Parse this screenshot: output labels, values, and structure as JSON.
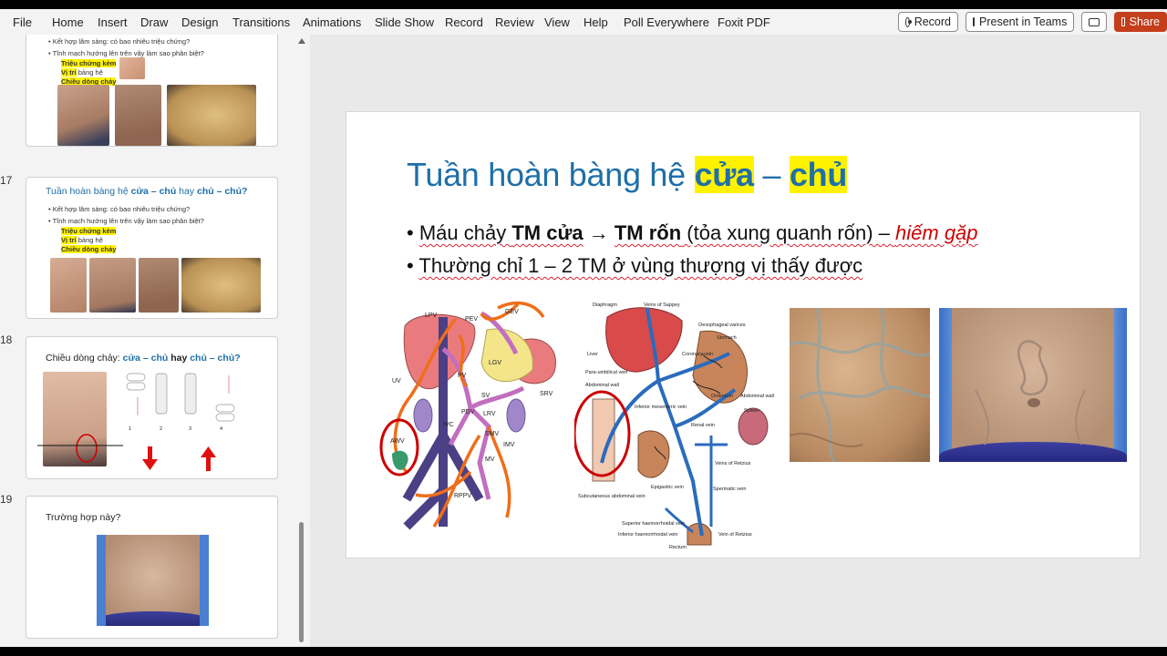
{
  "menu": {
    "file": "File",
    "home": "Home",
    "insert": "Insert",
    "draw": "Draw",
    "design": "Design",
    "transitions": "Transitions",
    "animations": "Animations",
    "slideshow": "Slide Show",
    "record": "Record",
    "review": "Review",
    "view": "View",
    "help": "Help",
    "poll": "Poll Everywhere",
    "foxit": "Foxit PDF"
  },
  "ribbon_buttons": {
    "record": "Record",
    "present": "Present in Teams",
    "share": "Share"
  },
  "thumbnails": {
    "t16": {
      "b1": "• Kết hợp lâm sàng: có bao nhiêu triệu chứng?",
      "b2": "• Tĩnh mạch hướng lên trên vậy làm sao phân biệt?",
      "s1": "Triệu chứng kèm",
      "s2a": "Vị trí",
      "s2b": " bàng hệ",
      "s3": "Chiều dòng chảy"
    },
    "t17": {
      "num": "17",
      "title_a": "Tuần hoàn bàng hệ ",
      "title_b": "cửa – chủ",
      "title_c": " hay ",
      "title_d": "chủ – chủ?",
      "b1": "• Kết hợp lâm sàng: có bao nhiêu triệu chứng?",
      "b2": "• Tĩnh mạch hướng lên trên vậy làm sao phân biệt?",
      "s1": "Triệu chứng kèm",
      "s2a": "Vị trí",
      "s2b": " bàng hệ",
      "s3": "Chiều dòng chảy"
    },
    "t18": {
      "num": "18",
      "title_a": "Chiều dòng chảy: ",
      "title_b": "cửa – chủ",
      "title_c": " hay ",
      "title_d": "chủ – chủ?",
      "fig_labels": [
        "1",
        "2",
        "3",
        "4"
      ]
    },
    "t19": {
      "num": "19",
      "title": "Trường hợp này?"
    }
  },
  "slide": {
    "title_a": "Tuần hoàn bàng hệ ",
    "title_b": "cửa",
    "title_c": " – ",
    "title_d": "chủ",
    "bullet1": {
      "dot": "•",
      "a": "Máu chảy ",
      "b": "TM cửa",
      "arrow": "→",
      "c": "TM rốn",
      "d": " (tỏa xung quanh rốn) – ",
      "e": "hiếm gặp"
    },
    "bullet2": {
      "dot": "•",
      "text": "Thường chỉ 1 – 2 TM ở vùng thượng vị thấy được"
    },
    "diagram1_labels": {
      "lpv": "LPV",
      "pev": "PEV",
      "gev": "GEV",
      "lgv": "LGV",
      "uv": "UV",
      "pv": "PV",
      "srv": "SRV",
      "sv": "SV",
      "pdv": "PDV",
      "lrv": "LRV",
      "ivc": "IVC",
      "smv": "SMV",
      "imv": "IMV",
      "mv": "MV",
      "awv": "AWV",
      "rppv": "RPPV"
    },
    "diagram2_labels": {
      "diaphragm": "Diaphragm",
      "sappey": "Veins of Sappey",
      "oeso": "Oesophageal varices",
      "stomach": "Stomach",
      "liver": "Liver",
      "paraumb": "Para-umbilical vein",
      "abdwall": "Abdominal wall",
      "coronary": "Coronary vein",
      "omentum": "Omentum",
      "abdwall2": "Abdominal wall",
      "spleen": "Spleen",
      "infmes": "Inferior mesenteric vein",
      "renal": "Renal vein",
      "retzius": "Veins of Retzius",
      "epigastric": "Epigastric vein",
      "subcut": "Subcutaneous abdominal vein",
      "spermatic": "Spermatic vein",
      "suphaem": "Superior haemorrhoidal vein",
      "infhaem": "Inferior haemorrhoidal vein",
      "rectum": "Rectum",
      "retzius2": "Vein of Retzius"
    }
  },
  "colors": {
    "title_blue": "#1f6fa8",
    "highlight": "#fff200",
    "rare_red": "#c00000",
    "share": "#c43e1c"
  }
}
